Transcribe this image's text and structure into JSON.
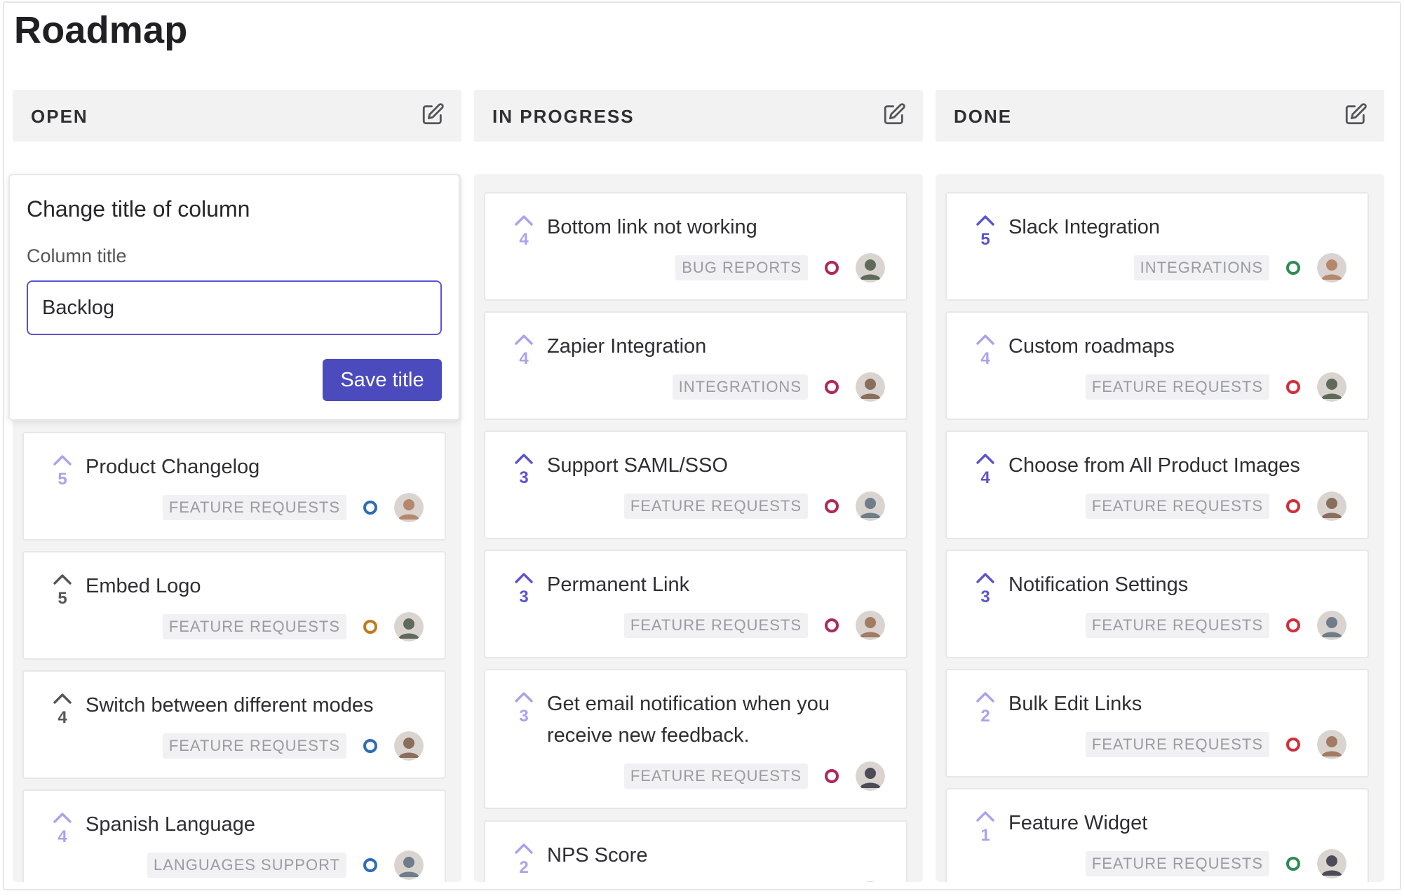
{
  "page": {
    "title": "Roadmap"
  },
  "columns": [
    {
      "title": "OPEN"
    },
    {
      "title": "IN PROGRESS"
    },
    {
      "title": "DONE"
    }
  ],
  "popover": {
    "heading": "Change title of column",
    "field_label": "Column title",
    "input_value": "Backlog",
    "save_label": "Save title"
  },
  "cards": {
    "open": [
      {
        "title": "Product Changelog",
        "votes": "5",
        "tag": "FEATURE REQUESTS",
        "status_color": "#2d6db5",
        "voted": false
      },
      {
        "title": "Embed Logo",
        "votes": "5",
        "tag": "FEATURE REQUESTS",
        "status_color": "#c07a1e",
        "voted": false
      },
      {
        "title": "Switch between different modes",
        "votes": "4",
        "tag": "FEATURE REQUESTS",
        "status_color": "#2d6db5",
        "voted": false
      },
      {
        "title": "Spanish Language",
        "votes": "4",
        "tag": "LANGUAGES SUPPORT",
        "status_color": "#2d6db5",
        "voted": false
      }
    ],
    "in_progress": [
      {
        "title": "Bottom link not working",
        "votes": "4",
        "tag": "BUG REPORTS",
        "status_color": "#b0285a",
        "voted": false
      },
      {
        "title": "Zapier Integration",
        "votes": "4",
        "tag": "INTEGRATIONS",
        "status_color": "#b0285a",
        "voted": false
      },
      {
        "title": "Support SAML/SSO",
        "votes": "3",
        "tag": "FEATURE REQUESTS",
        "status_color": "#b0285a",
        "voted": true
      },
      {
        "title": "Permanent Link",
        "votes": "3",
        "tag": "FEATURE REQUESTS",
        "status_color": "#b0285a",
        "voted": true
      },
      {
        "title": "Get email notification when you receive new feedback.",
        "votes": "3",
        "tag": "FEATURE REQUESTS",
        "status_color": "#b0285a",
        "voted": false
      },
      {
        "title": "NPS Score",
        "votes": "2",
        "tag": "",
        "status_color": "#b0285a",
        "voted": false
      }
    ],
    "done": [
      {
        "title": "Slack Integration",
        "votes": "5",
        "tag": "INTEGRATIONS",
        "status_color": "#2e8b57",
        "voted": true
      },
      {
        "title": "Custom roadmaps",
        "votes": "4",
        "tag": "FEATURE REQUESTS",
        "status_color": "#d12f3a",
        "voted": false
      },
      {
        "title": "Choose from All Product Images",
        "votes": "4",
        "tag": "FEATURE REQUESTS",
        "status_color": "#d12f3a",
        "voted": true
      },
      {
        "title": "Notification Settings",
        "votes": "3",
        "tag": "FEATURE REQUESTS",
        "status_color": "#d12f3a",
        "voted": true
      },
      {
        "title": "Bulk Edit Links",
        "votes": "2",
        "tag": "FEATURE REQUESTS",
        "status_color": "#d12f3a",
        "voted": false
      },
      {
        "title": "Feature Widget",
        "votes": "1",
        "tag": "FEATURE REQUESTS",
        "status_color": "#2e8b57",
        "voted": false
      }
    ]
  },
  "colors": {
    "accent": "#4c4bbd",
    "vote_active": "#5b53cf",
    "vote_idle": "#a9a2ee",
    "vote_neutral": "#55555a"
  }
}
